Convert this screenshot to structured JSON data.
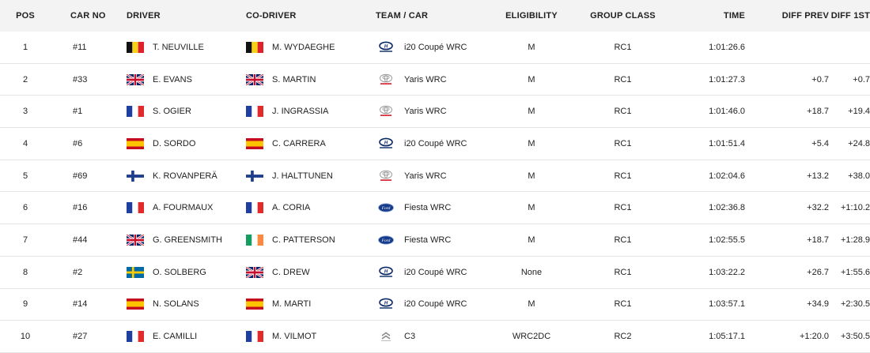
{
  "headers": {
    "pos": "POS",
    "car": "CAR NO",
    "driver": "DRIVER",
    "codriver": "CO-DRIVER",
    "team": "TEAM / CAR",
    "elig": "ELIGIBILITY",
    "group": "GROUP CLASS",
    "time": "TIME",
    "diffprev": "DIFF PREV",
    "diff1": "DIFF 1ST"
  },
  "rows": [
    {
      "pos": "1",
      "car": "#11",
      "driver": "T. NEUVILLE",
      "driver_flag": "be",
      "codriver": "M. WYDAEGHE",
      "codriver_flag": "be",
      "team_logo": "hyundai-logo-icon",
      "team": "i20 Coupé WRC",
      "elig": "M",
      "group": "RC1",
      "time": "1:01:26.6",
      "diffprev": "",
      "diff1": ""
    },
    {
      "pos": "2",
      "car": "#33",
      "driver": "E. EVANS",
      "driver_flag": "gb",
      "codriver": "S. MARTIN",
      "codriver_flag": "gb",
      "team_logo": "toyota-logo-icon",
      "team": "Yaris WRC",
      "elig": "M",
      "group": "RC1",
      "time": "1:01:27.3",
      "diffprev": "+0.7",
      "diff1": "+0.7"
    },
    {
      "pos": "3",
      "car": "#1",
      "driver": "S. OGIER",
      "driver_flag": "fr",
      "codriver": "J. INGRASSIA",
      "codriver_flag": "fr",
      "team_logo": "toyota-logo-icon",
      "team": "Yaris WRC",
      "elig": "M",
      "group": "RC1",
      "time": "1:01:46.0",
      "diffprev": "+18.7",
      "diff1": "+19.4"
    },
    {
      "pos": "4",
      "car": "#6",
      "driver": "D. SORDO",
      "driver_flag": "es",
      "codriver": "C. CARRERA",
      "codriver_flag": "es",
      "team_logo": "hyundai-logo-icon",
      "team": "i20 Coupé WRC",
      "elig": "M",
      "group": "RC1",
      "time": "1:01:51.4",
      "diffprev": "+5.4",
      "diff1": "+24.8"
    },
    {
      "pos": "5",
      "car": "#69",
      "driver": "K. ROVANPERÄ",
      "driver_flag": "fi",
      "codriver": "J. HALTTUNEN",
      "codriver_flag": "fi",
      "team_logo": "toyota-logo-icon",
      "team": "Yaris WRC",
      "elig": "M",
      "group": "RC1",
      "time": "1:02:04.6",
      "diffprev": "+13.2",
      "diff1": "+38.0"
    },
    {
      "pos": "6",
      "car": "#16",
      "driver": "A. FOURMAUX",
      "driver_flag": "fr",
      "codriver": "A. CORIA",
      "codriver_flag": "fr",
      "team_logo": "ford-logo-icon",
      "team": "Fiesta WRC",
      "elig": "M",
      "group": "RC1",
      "time": "1:02:36.8",
      "diffprev": "+32.2",
      "diff1": "+1:10.2"
    },
    {
      "pos": "7",
      "car": "#44",
      "driver": "G. GREENSMITH",
      "driver_flag": "gb",
      "codriver": "C. PATTERSON",
      "codriver_flag": "ie",
      "team_logo": "ford-logo-icon",
      "team": "Fiesta WRC",
      "elig": "M",
      "group": "RC1",
      "time": "1:02:55.5",
      "diffprev": "+18.7",
      "diff1": "+1:28.9"
    },
    {
      "pos": "8",
      "car": "#2",
      "driver": "O. SOLBERG",
      "driver_flag": "se",
      "codriver": "C. DREW",
      "codriver_flag": "gb",
      "team_logo": "hyundai-logo-icon",
      "team": "i20 Coupé WRC",
      "elig": "None",
      "group": "RC1",
      "time": "1:03:22.2",
      "diffprev": "+26.7",
      "diff1": "+1:55.6"
    },
    {
      "pos": "9",
      "car": "#14",
      "driver": "N. SOLANS",
      "driver_flag": "es",
      "codriver": "M. MARTI",
      "codriver_flag": "es",
      "team_logo": "hyundai-logo-icon",
      "team": "i20 Coupé WRC",
      "elig": "M",
      "group": "RC1",
      "time": "1:03:57.1",
      "diffprev": "+34.9",
      "diff1": "+2:30.5"
    },
    {
      "pos": "10",
      "car": "#27",
      "driver": "E. CAMILLI",
      "driver_flag": "fr",
      "codriver": "M. VILMOT",
      "codriver_flag": "fr",
      "team_logo": "citroen-logo-icon",
      "team": "C3",
      "elig": "WRC2DC",
      "group": "RC2",
      "time": "1:05:17.1",
      "diffprev": "+1:20.0",
      "diff1": "+3:50.5"
    }
  ]
}
